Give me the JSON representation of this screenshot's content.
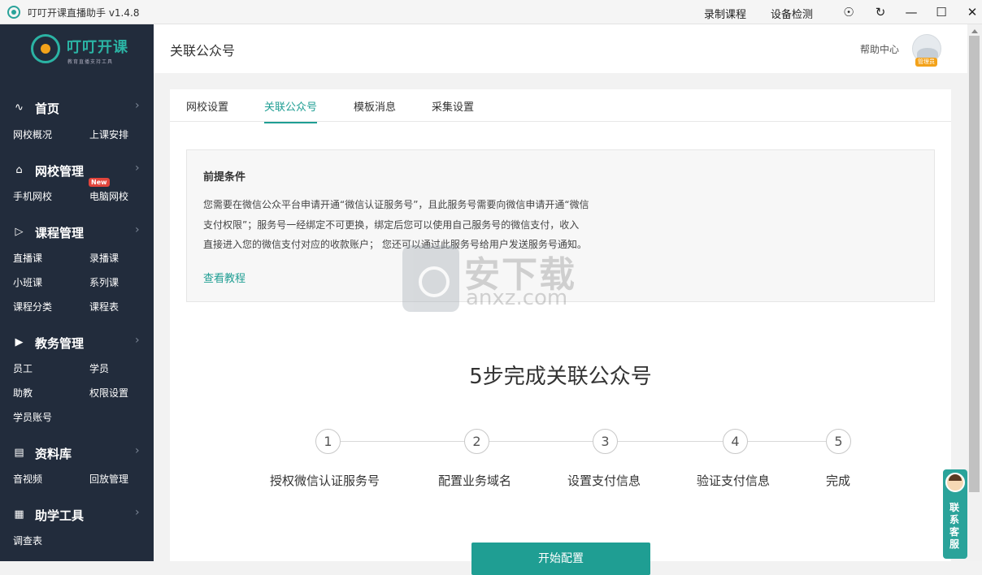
{
  "titlebar": {
    "app_title": "叮叮开课直播助手 v1.4.8",
    "record_label": "录制课程",
    "device_check_label": "设备检测"
  },
  "logo": {
    "name": "叮叮开课",
    "slogan": "教育直播支持工具"
  },
  "sidebar": {
    "groups": [
      {
        "label": "首页",
        "icon": "chart-icon",
        "items": [
          "网校概况",
          "上课安排"
        ]
      },
      {
        "label": "网校管理",
        "icon": "store-icon",
        "items": [
          "手机网校",
          "电脑网校"
        ],
        "badge": "New"
      },
      {
        "label": "课程管理",
        "icon": "video-icon",
        "items": [
          "直播课",
          "录播课",
          "小班课",
          "系列课",
          "课程分类",
          "课程表"
        ]
      },
      {
        "label": "教务管理",
        "icon": "play-icon",
        "items": [
          "员工",
          "学员",
          "助教",
          "权限设置",
          "学员账号"
        ]
      },
      {
        "label": "资料库",
        "icon": "library-icon",
        "items": [
          "音视频",
          "回放管理"
        ]
      },
      {
        "label": "助学工具",
        "icon": "tools-icon",
        "items": [
          "调查表"
        ]
      }
    ]
  },
  "header": {
    "title": "关联公众号",
    "help": "帮助中心",
    "admin_badge": "管理员"
  },
  "tabs": [
    "网校设置",
    "关联公众号",
    "模板消息",
    "采集设置"
  ],
  "active_tab": 1,
  "notice": {
    "title": "前提条件",
    "lines": [
      "您需要在微信公众平台申请开通“微信认证服务号”，且此服务号需要向微信申请开通“微信",
      "支付权限”；服务号一经绑定不可更换，绑定后您可以使用自己服务号的微信支付，收入",
      "直接进入您的微信支付对应的收款账户； 您还可以通过此服务号给用户发送服务号通知。"
    ],
    "link": "查看教程"
  },
  "watermark": {
    "cn": "安下载",
    "en": "anxz.com"
  },
  "steps": {
    "title": "5步完成关联公众号",
    "items": [
      {
        "num": "1",
        "label": "授权微信认证服务号"
      },
      {
        "num": "2",
        "label": "配置业务域名"
      },
      {
        "num": "3",
        "label": "设置支付信息"
      },
      {
        "num": "4",
        "label": "验证支付信息"
      },
      {
        "num": "5",
        "label": "完成"
      }
    ]
  },
  "start_button": "开始配置",
  "service": "联系客服",
  "colors": {
    "accent": "#1f9e93",
    "sidebar": "#222c3c"
  }
}
